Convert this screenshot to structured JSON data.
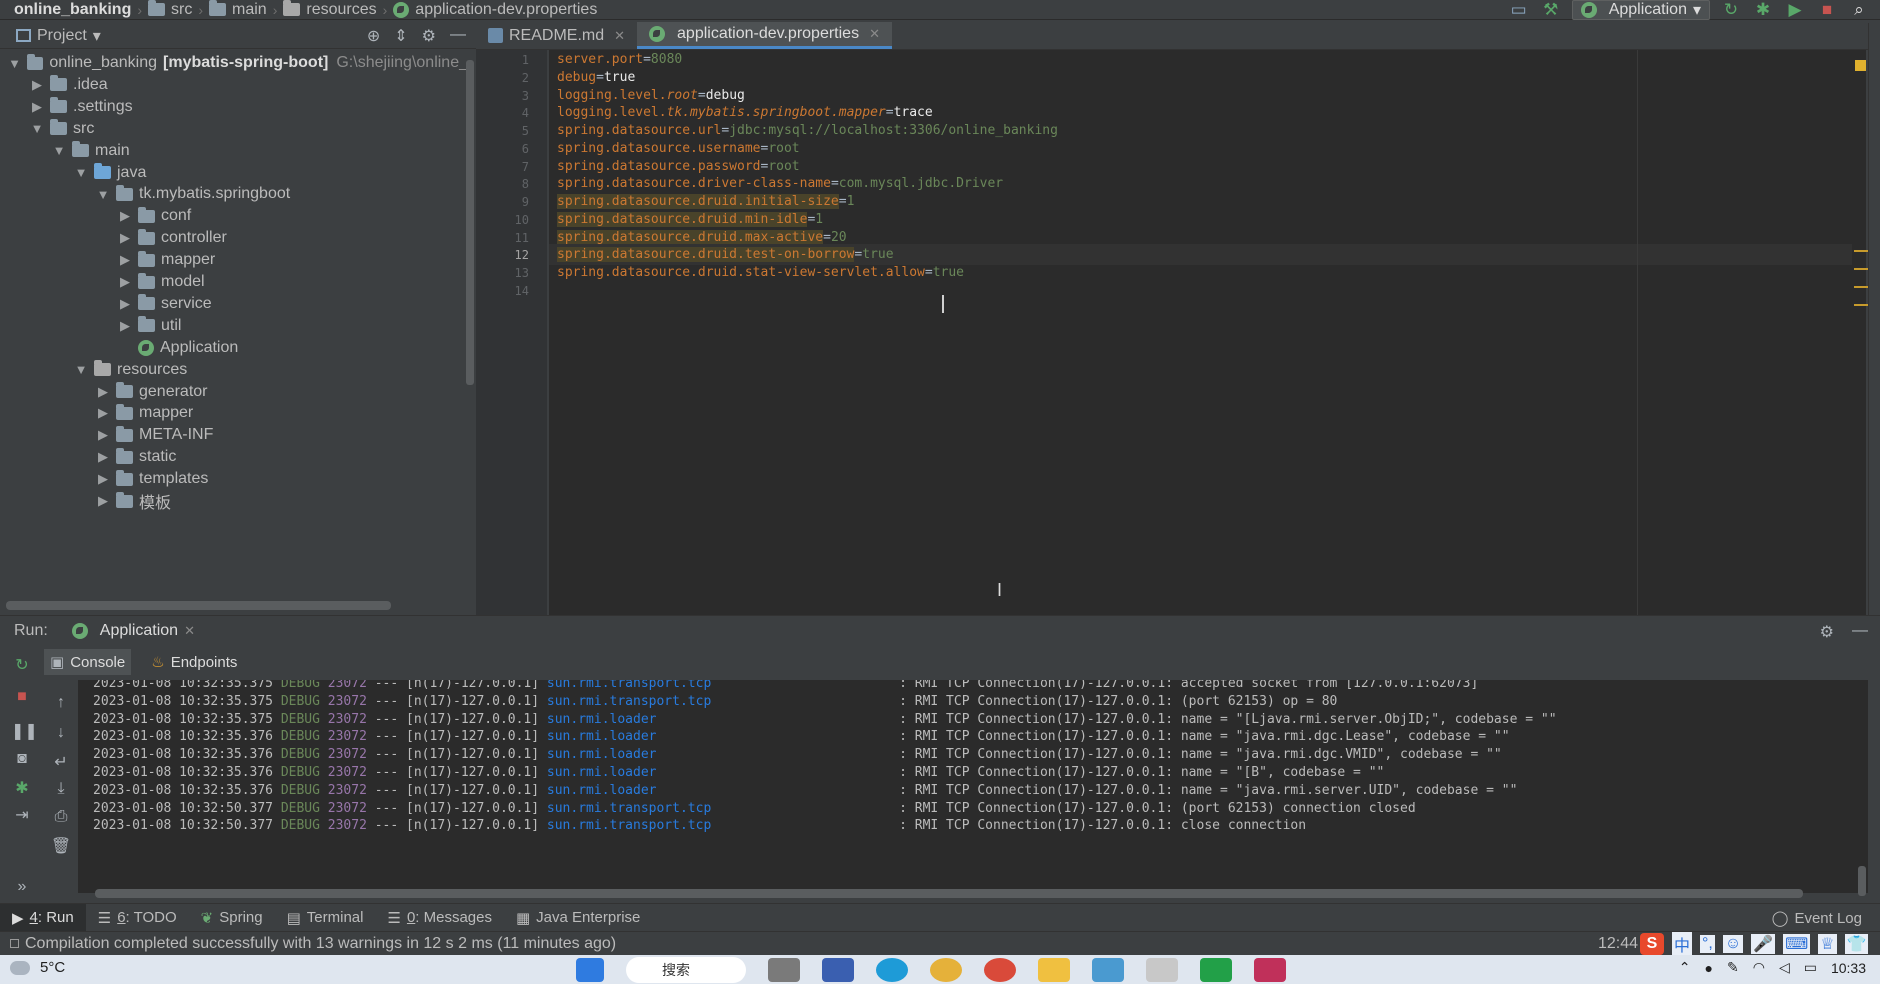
{
  "navbar": {
    "crumbs": [
      "online_banking",
      "src",
      "main",
      "resources",
      "application-dev.properties"
    ],
    "run_config": "Application"
  },
  "project_panel": {
    "title": "Project",
    "tree": [
      {
        "label": "online_banking",
        "bold": "[mybatis-spring-boot]",
        "extra": "G:\\shejiing\\online_",
        "icon": "module-icon",
        "expanded": true,
        "depth": 0
      },
      {
        "label": ".idea",
        "icon": "folder-icon",
        "expanded": false,
        "depth": 1
      },
      {
        "label": ".settings",
        "icon": "folder-icon",
        "expanded": false,
        "depth": 1
      },
      {
        "label": "src",
        "icon": "folder-icon",
        "expanded": true,
        "depth": 1
      },
      {
        "label": "main",
        "icon": "folder-icon",
        "expanded": true,
        "depth": 2
      },
      {
        "label": "java",
        "icon": "source-folder-icon",
        "expanded": true,
        "depth": 3
      },
      {
        "label": "tk.mybatis.springboot",
        "icon": "package-icon",
        "expanded": true,
        "depth": 4
      },
      {
        "label": "conf",
        "icon": "package-icon",
        "expanded": false,
        "depth": 5
      },
      {
        "label": "controller",
        "icon": "package-icon",
        "expanded": false,
        "depth": 5
      },
      {
        "label": "mapper",
        "icon": "package-icon",
        "expanded": false,
        "depth": 5
      },
      {
        "label": "model",
        "icon": "package-icon",
        "expanded": false,
        "depth": 5
      },
      {
        "label": "service",
        "icon": "package-icon",
        "expanded": false,
        "depth": 5
      },
      {
        "label": "util",
        "icon": "package-icon",
        "expanded": false,
        "depth": 5
      },
      {
        "label": "Application",
        "icon": "spring-class-icon",
        "expanded": null,
        "depth": 5
      },
      {
        "label": "resources",
        "icon": "resources-folder-icon",
        "expanded": true,
        "depth": 3
      },
      {
        "label": "generator",
        "icon": "folder-icon",
        "expanded": false,
        "depth": 4
      },
      {
        "label": "mapper",
        "icon": "folder-icon",
        "expanded": false,
        "depth": 4
      },
      {
        "label": "META-INF",
        "icon": "folder-icon",
        "expanded": false,
        "depth": 4
      },
      {
        "label": "static",
        "icon": "folder-icon",
        "expanded": false,
        "depth": 4
      },
      {
        "label": "templates",
        "icon": "folder-icon",
        "expanded": false,
        "depth": 4
      },
      {
        "label": "模板",
        "icon": "folder-icon",
        "expanded": false,
        "depth": 4
      }
    ]
  },
  "editor": {
    "tabs": [
      {
        "label": "README.md",
        "active": false
      },
      {
        "label": "application-dev.properties",
        "active": true
      }
    ],
    "line_numbers": [
      "1",
      "2",
      "3",
      "4",
      "5",
      "6",
      "7",
      "8",
      "9",
      "10",
      "11",
      "12",
      "13",
      "14"
    ],
    "current_line": 12,
    "lines": [
      {
        "key": "server.port",
        "value": "8080"
      },
      {
        "key": "debug",
        "value": "true"
      },
      {
        "key": "logging.level.root",
        "value": "debug"
      },
      {
        "key": "logging.level.tk.mybatis.springboot.mapper",
        "value": "trace"
      },
      {
        "key": "spring.datasource.url",
        "value": "jdbc:mysql://localhost:3306/online_banking"
      },
      {
        "key": "spring.datasource.username",
        "value": "root"
      },
      {
        "key": "spring.datasource.password",
        "value": "root"
      },
      {
        "key": "spring.datasource.driver-class-name",
        "value": "com.mysql.jdbc.Driver"
      },
      {
        "key": "spring.datasource.druid.initial-size",
        "value": "1"
      },
      {
        "key": "spring.datasource.druid.min-idle",
        "value": "1"
      },
      {
        "key": "spring.datasource.druid.max-active",
        "value": "20"
      },
      {
        "key": "spring.datasource.druid.test-on-borrow",
        "value": "true"
      },
      {
        "key": "spring.datasource.druid.stat-view-servlet.allow",
        "value": "true"
      },
      {
        "key": "",
        "value": ""
      }
    ]
  },
  "run_panel": {
    "label": "Run:",
    "tab": "Application",
    "subtabs": [
      "Console",
      "Endpoints"
    ],
    "logs": [
      {
        "ts": "2023-01-08 10:32:35.375",
        "level": "DEBUG",
        "pid": "23072",
        "sep": "---",
        "thread": "[n(17)-127.0.0.1]",
        "logger": "sun.rmi.transport.tcp",
        "msg": ": RMI TCP Connection(17)-127.0.0.1: accepted socket from [127.0.0.1:62073]"
      },
      {
        "ts": "2023-01-08 10:32:35.375",
        "level": "DEBUG",
        "pid": "23072",
        "sep": "---",
        "thread": "[n(17)-127.0.0.1]",
        "logger": "sun.rmi.transport.tcp",
        "msg": ": RMI TCP Connection(17)-127.0.0.1: (port 62153) op = 80"
      },
      {
        "ts": "2023-01-08 10:32:35.375",
        "level": "DEBUG",
        "pid": "23072",
        "sep": "---",
        "thread": "[n(17)-127.0.0.1]",
        "logger": "sun.rmi.loader",
        "msg": ": RMI TCP Connection(17)-127.0.0.1: name = \"[Ljava.rmi.server.ObjID;\", codebase = \"\""
      },
      {
        "ts": "2023-01-08 10:32:35.376",
        "level": "DEBUG",
        "pid": "23072",
        "sep": "---",
        "thread": "[n(17)-127.0.0.1]",
        "logger": "sun.rmi.loader",
        "msg": ": RMI TCP Connection(17)-127.0.0.1: name = \"java.rmi.dgc.Lease\", codebase = \"\""
      },
      {
        "ts": "2023-01-08 10:32:35.376",
        "level": "DEBUG",
        "pid": "23072",
        "sep": "---",
        "thread": "[n(17)-127.0.0.1]",
        "logger": "sun.rmi.loader",
        "msg": ": RMI TCP Connection(17)-127.0.0.1: name = \"java.rmi.dgc.VMID\", codebase = \"\""
      },
      {
        "ts": "2023-01-08 10:32:35.376",
        "level": "DEBUG",
        "pid": "23072",
        "sep": "---",
        "thread": "[n(17)-127.0.0.1]",
        "logger": "sun.rmi.loader",
        "msg": ": RMI TCP Connection(17)-127.0.0.1: name = \"[B\", codebase = \"\""
      },
      {
        "ts": "2023-01-08 10:32:35.376",
        "level": "DEBUG",
        "pid": "23072",
        "sep": "---",
        "thread": "[n(17)-127.0.0.1]",
        "logger": "sun.rmi.loader",
        "msg": ": RMI TCP Connection(17)-127.0.0.1: name = \"java.rmi.server.UID\", codebase = \"\""
      },
      {
        "ts": "2023-01-08 10:32:50.377",
        "level": "DEBUG",
        "pid": "23072",
        "sep": "---",
        "thread": "[n(17)-127.0.0.1]",
        "logger": "sun.rmi.transport.tcp",
        "msg": ": RMI TCP Connection(17)-127.0.0.1: (port 62153) connection closed"
      },
      {
        "ts": "2023-01-08 10:32:50.377",
        "level": "DEBUG",
        "pid": "23072",
        "sep": "---",
        "thread": "[n(17)-127.0.0.1]",
        "logger": "sun.rmi.transport.tcp",
        "msg": ": RMI TCP Connection(17)-127.0.0.1: close connection"
      }
    ]
  },
  "tool_windows": {
    "run": {
      "num": "4",
      "label": ": Run"
    },
    "todo": {
      "num": "6",
      "label": ": TODO"
    },
    "spring": "Spring",
    "terminal": "Terminal",
    "messages": {
      "num": "0",
      "label": ": Messages"
    },
    "java_enterprise": "Java Enterprise",
    "event_log": "Event Log"
  },
  "status": {
    "message": "Compilation completed successfully with 13 warnings in 12 s 2 ms (11 minutes ago)",
    "time": "12:44",
    "ime_logo": "S",
    "ime_mode": "中"
  },
  "taskbar": {
    "weather": "5°C",
    "search": "搜索",
    "clock": "10:33"
  },
  "colors": {
    "accent": "#4a88c7",
    "editor_bg": "#2b2b2b",
    "panel_bg": "#3c3f41",
    "key": "#cc7832",
    "value": "#6a8759",
    "logger": "#287bde"
  }
}
